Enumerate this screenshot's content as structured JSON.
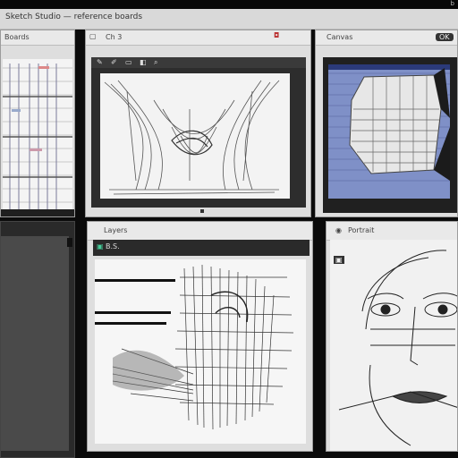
{
  "window": {
    "title": "Sketch Studio — reference boards",
    "corner_text": "b"
  },
  "panels": {
    "left": {
      "title": "Boards"
    },
    "center_top": {
      "title": "Ch 3",
      "tools": [
        "brush",
        "pencil",
        "eraser",
        "fill",
        "zoom"
      ]
    },
    "right_top": {
      "title": "Canvas",
      "btn": "OK"
    },
    "center_bottom": {
      "title": "Layers",
      "label": "B.S."
    },
    "right_bottom": {
      "title": "Portrait"
    }
  },
  "colors": {
    "accent": "#3a7bd5",
    "dark": "#262626",
    "paper": "#f3f3f3"
  }
}
